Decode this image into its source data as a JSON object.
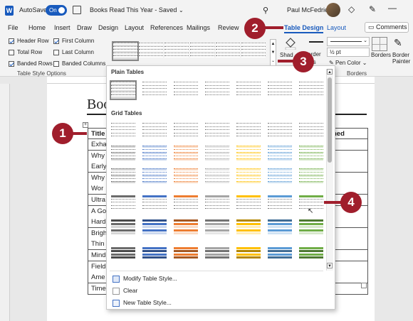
{
  "titlebar": {
    "autosave_label": "AutoSave",
    "autosave_state": "On",
    "doc_title": "Books Read This Year - Saved",
    "user_name": "Paul McFedries"
  },
  "tabs": [
    {
      "label": "File"
    },
    {
      "label": "Home"
    },
    {
      "label": "Insert"
    },
    {
      "label": "Draw"
    },
    {
      "label": "Design"
    },
    {
      "label": "Layout"
    },
    {
      "label": "References"
    },
    {
      "label": "Mailings"
    },
    {
      "label": "Review"
    },
    {
      "label": "Table Design"
    },
    {
      "label": "Layout"
    }
  ],
  "comments_label": "Comments",
  "style_options": {
    "group_label": "Table Style Options",
    "header_row": "Header Row",
    "first_column": "First Column",
    "total_row": "Total Row",
    "last_column": "Last Column",
    "banded_rows": "Banded Rows",
    "banded_columns": "Banded Columns"
  },
  "ribbon": {
    "shading_label": "Shad",
    "border_label": "order",
    "border_sub": "tes",
    "weight_value": "½ pt",
    "pen_color_label": "Pen Color",
    "borders_label": "Borders",
    "borders_painter_label": "Border Painter",
    "borders_group_label": "Borders"
  },
  "gallery": {
    "plain_header": "Plain Tables",
    "grid_header": "Grid Tables",
    "menu": [
      {
        "label": "Modify Table Style..."
      },
      {
        "label": "Clear"
      },
      {
        "label": "New Table Style..."
      }
    ],
    "grid_colors": [
      "#6b6b6b",
      "#4472c4",
      "#ed7d31",
      "#a5a5a5",
      "#ffc000",
      "#5b9bd5",
      "#70ad47"
    ]
  },
  "document": {
    "heading": "Boo",
    "header_title": "Title",
    "header_right": "hed",
    "rows": [
      "Exha",
      "Why",
      "Early",
      "Why",
      "Wor",
      "Ultra",
      "A Go",
      "Hard",
      "Brigh",
      "Thin",
      "Mind",
      "Field",
      "Ame",
      "Time"
    ]
  },
  "callouts": [
    "1",
    "2",
    "3",
    "4"
  ]
}
